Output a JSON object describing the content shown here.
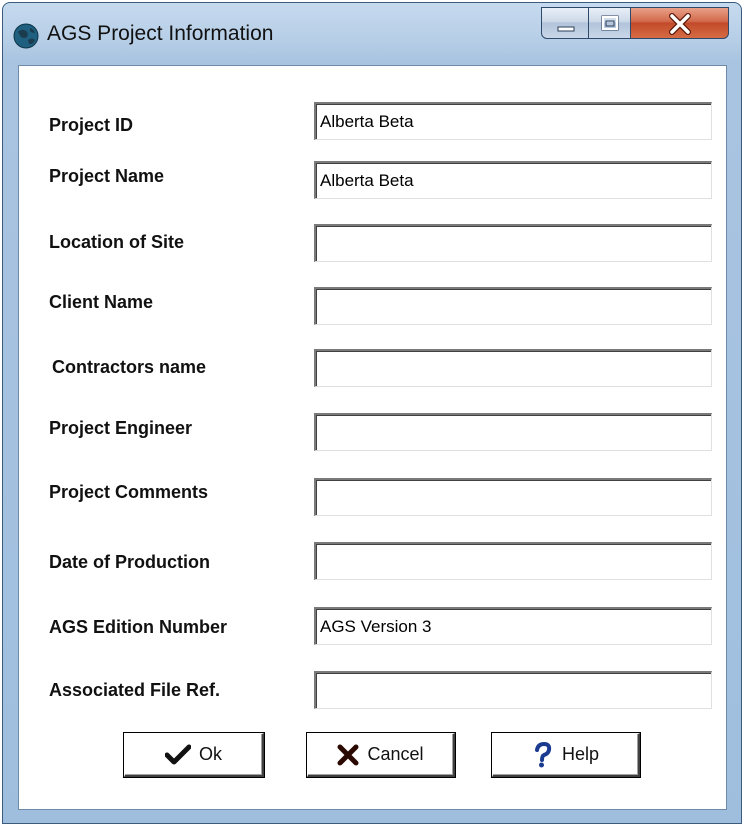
{
  "window": {
    "title": "AGS Project Information"
  },
  "form": {
    "fields": [
      {
        "label": "Project ID",
        "value": "Alberta Beta"
      },
      {
        "label": "Project Name",
        "value": "Alberta Beta"
      },
      {
        "label": "Location of Site",
        "value": ""
      },
      {
        "label": "Client Name",
        "value": ""
      },
      {
        "label": "Contractors name",
        "value": ""
      },
      {
        "label": "Project Engineer",
        "value": ""
      },
      {
        "label": "Project Comments",
        "value": ""
      },
      {
        "label": "Date of Production",
        "value": ""
      },
      {
        "label": "AGS Edition Number",
        "value": "AGS Version 3"
      },
      {
        "label": "Associated File Ref.",
        "value": ""
      }
    ]
  },
  "buttons": {
    "ok": {
      "label": "Ok",
      "icon": "checkmark-icon"
    },
    "cancel": {
      "label": "Cancel",
      "icon": "x-cross-icon"
    },
    "help": {
      "label": "Help",
      "icon": "question-mark-icon"
    }
  },
  "colors": {
    "check": "#111111",
    "cross": "#2a0a00",
    "help": "#1a3b8f",
    "close_button": "#c9553a"
  }
}
